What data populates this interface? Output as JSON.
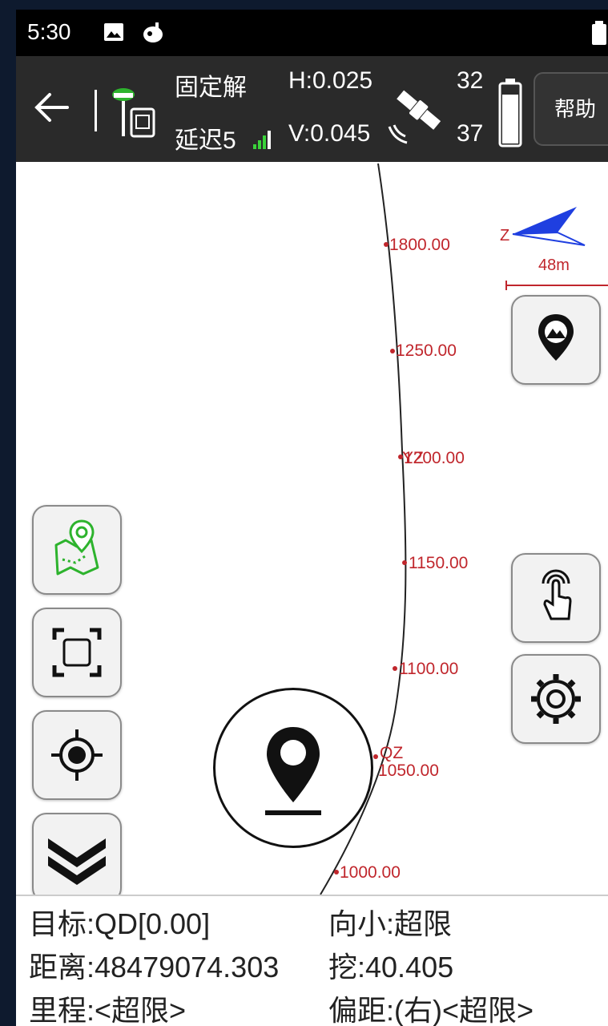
{
  "status_bar": {
    "time": "5:30",
    "icons": [
      "image-icon",
      "app-notification-icon",
      "battery-icon"
    ]
  },
  "toolbar": {
    "back_icon": "back-arrow-icon",
    "device_icon": "gnss-receiver-icon",
    "solution_status": "固定解",
    "latency": "延迟5",
    "h_precision": "H:0.025",
    "v_precision": "V:0.045",
    "satellite_icon": "satellite-icon",
    "sats_used": "32",
    "sats_tracked": "37",
    "battery_icon": "battery-icon",
    "help_label": "帮助"
  },
  "map": {
    "north_label": "Z",
    "scale_label": "48m",
    "stations": [
      {
        "label": "1800.00"
      },
      {
        "label": "1250.00"
      },
      {
        "label": "YZ"
      },
      {
        "label": "1200.00"
      },
      {
        "label": "1150.00"
      },
      {
        "label": "1100.00"
      },
      {
        "label": "QZ"
      },
      {
        "label": "1050.00"
      },
      {
        "label": "1000.00"
      }
    ],
    "colors": {
      "curve": "#222222",
      "labels": "#c0262c",
      "compass": "#1f3fe0"
    }
  },
  "controls": {
    "left": [
      "map-data-icon",
      "full-extent-icon",
      "locate-icon",
      "collapse-icon"
    ],
    "right": [
      "base-map-icon",
      "touch-select-icon",
      "settings-icon"
    ],
    "center": "stakeout-point-icon"
  },
  "info": {
    "target": "目标:QD[0.00]",
    "direction": "向小:超限",
    "distance": "距离:48479074.303",
    "cut": "挖:40.405",
    "mileage": "里程:<超限>",
    "offset": "偏距:(右)<超限>"
  }
}
